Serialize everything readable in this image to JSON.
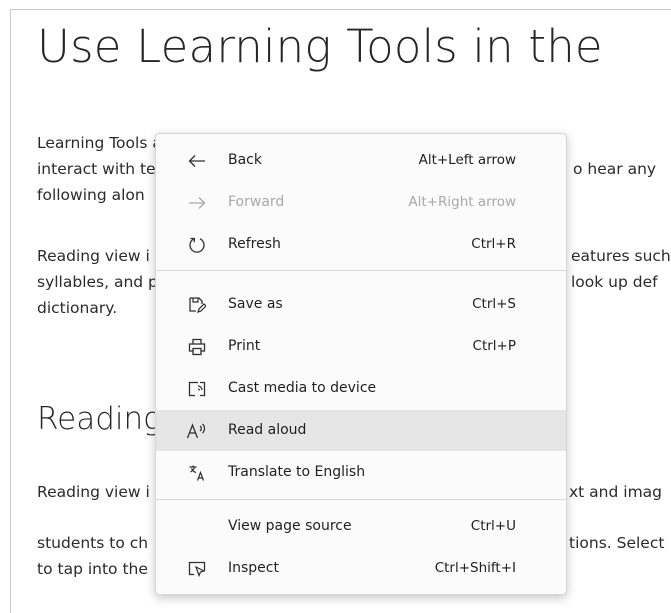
{
  "page": {
    "title": "Use Learning Tools in the",
    "paragraph1": [
      "Learning Tools are built into the Microsoft Edge browser, adding mor",
      "interact with te",
      "following alon"
    ],
    "paragraph1_right": [
      "o hear any"
    ],
    "paragraph2": [
      "Reading view i",
      "syllables, and p",
      "dictionary."
    ],
    "paragraph2_right": [
      "eatures such",
      "look up def"
    ],
    "heading2": "Reading",
    "paragraph3": [
      "Reading view i"
    ],
    "paragraph3_right": [
      "xt and imag"
    ],
    "paragraph4": [
      "students to ch",
      "to tap into the"
    ],
    "paragraph4_right": [
      "tions. Select"
    ]
  },
  "context_menu": {
    "items": [
      {
        "label": "Back",
        "shortcut": "Alt+Left arrow",
        "icon": "arrow-left-icon",
        "enabled": true
      },
      {
        "label": "Forward",
        "shortcut": "Alt+Right arrow",
        "icon": "arrow-right-icon",
        "enabled": false
      },
      {
        "label": "Refresh",
        "shortcut": "Ctrl+R",
        "icon": "refresh-icon",
        "enabled": true
      },
      {
        "label": "Save as",
        "shortcut": "Ctrl+S",
        "icon": "save-as-icon",
        "enabled": true
      },
      {
        "label": "Print",
        "shortcut": "Ctrl+P",
        "icon": "printer-icon",
        "enabled": true
      },
      {
        "label": "Cast media to device",
        "shortcut": "",
        "icon": "cast-icon",
        "enabled": true
      },
      {
        "label": "Read aloud",
        "shortcut": "",
        "icon": "read-aloud-icon",
        "enabled": true,
        "highlighted": true
      },
      {
        "label": "Translate to English",
        "shortcut": "",
        "icon": "translate-icon",
        "enabled": true
      },
      {
        "label": "View page source",
        "shortcut": "Ctrl+U",
        "icon": "",
        "enabled": true
      },
      {
        "label": "Inspect",
        "shortcut": "Ctrl+Shift+I",
        "icon": "inspect-icon",
        "enabled": true
      }
    ]
  },
  "colors": {
    "highlight": "#e6e6e6",
    "disabled_text": "#a8a8a8",
    "menu_bg": "#fbfbfb"
  }
}
